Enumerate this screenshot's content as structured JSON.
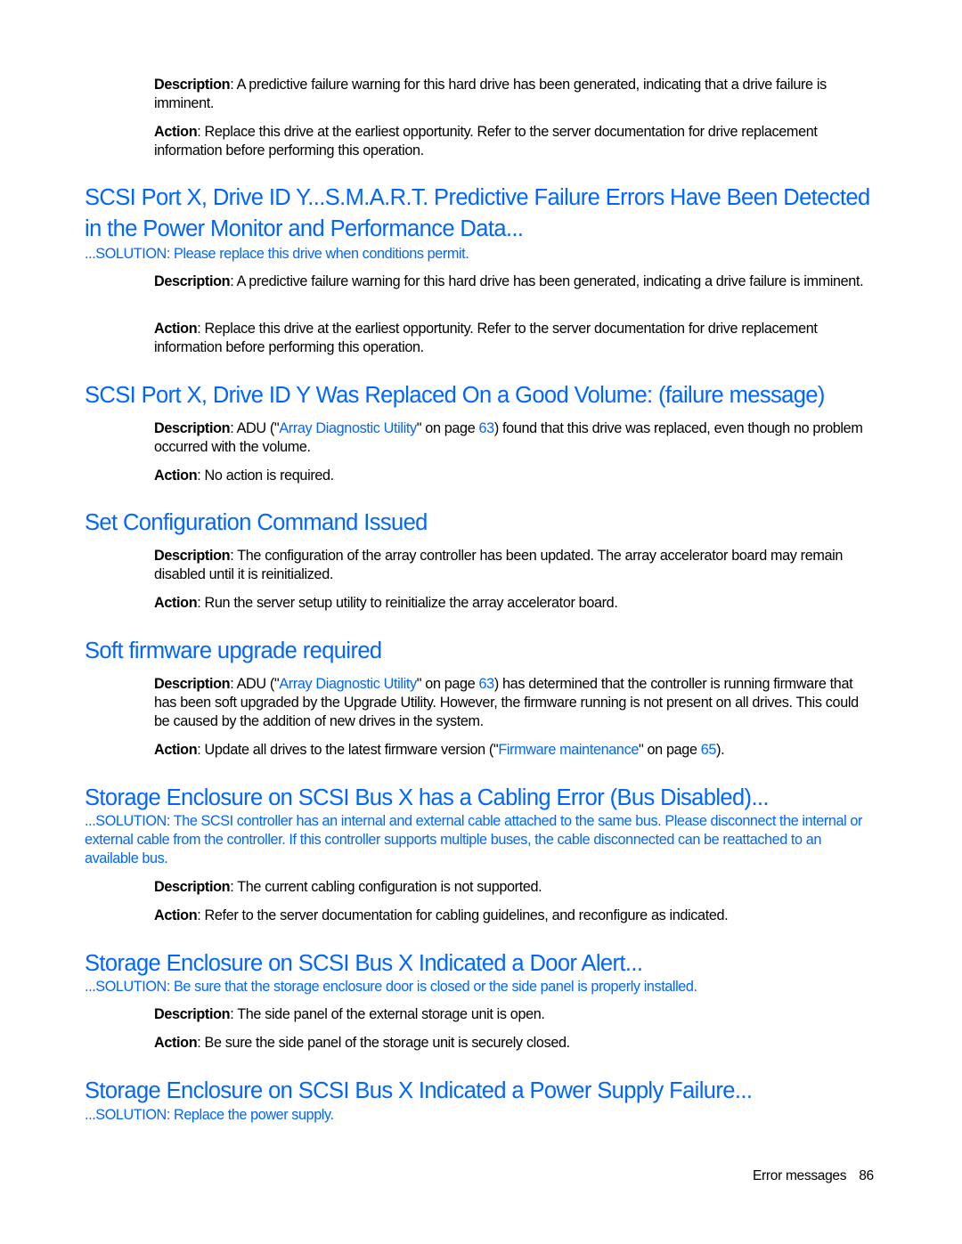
{
  "footer": {
    "section": "Error messages",
    "page": "86"
  },
  "labels": {
    "description": "Description",
    "action": "Action"
  },
  "block0": {
    "description": ": A predictive failure warning for this hard drive has been generated, indicating that a drive failure is imminent.",
    "action": ": Replace this drive at the earliest opportunity. Refer to the server documentation for drive replacement information before performing this operation."
  },
  "sections": [
    {
      "heading_line1": "SCSI Port X, Drive ID Y...S.M.A.R.T. Predictive Failure Errors Have Been Detected",
      "heading_line2": "in the Power Monitor and Performance Data...",
      "solution": "...SOLUTION: Please replace this drive when conditions permit.",
      "description": ": A predictive failure warning for this hard drive has been generated, indicating a drive failure is imminent.",
      "action": ": Replace this drive at the earliest opportunity. Refer to the server documentation for drive replacement information before performing this operation."
    },
    {
      "heading": "SCSI Port X, Drive ID Y Was Replaced On a Good Volume: (failure message)",
      "description_pre": ": ADU (\"",
      "description_link": "Array Diagnostic Utility",
      "description_mid": "\" on page ",
      "description_page": "63",
      "description_post": ") found that this drive was replaced, even though no problem occurred with the volume.",
      "action": ": No action is required."
    },
    {
      "heading": "Set Configuration Command Issued",
      "description": ": The configuration of the array controller has been updated. The array accelerator board may remain disabled until it is reinitialized.",
      "action": ": Run the server setup utility to reinitialize the array accelerator board."
    },
    {
      "heading": "Soft firmware upgrade required",
      "description_pre": ": ADU (\"",
      "description_link": "Array Diagnostic Utility",
      "description_mid": "\" on page ",
      "description_page": "63",
      "description_post": ") has determined that the controller is running firmware that has been soft upgraded by the Upgrade Utility. However, the firmware running is not present on all drives. This could be caused by the addition of new drives in the system.",
      "action_pre": ": Update all drives to the latest firmware version (\"",
      "action_link": "Firmware maintenance",
      "action_mid": "\" on page ",
      "action_page": "65",
      "action_post": ")."
    },
    {
      "heading": "Storage Enclosure on SCSI Bus X has a Cabling Error (Bus Disabled)...",
      "solution": "...SOLUTION: The SCSI controller has an internal and external cable attached to the same bus. Please disconnect the internal or external cable from the controller. If this controller supports multiple buses, the cable disconnected can be reattached to an available bus.",
      "description": ": The current cabling configuration is not supported.",
      "action": ": Refer to the server documentation for cabling guidelines, and reconfigure as indicated."
    },
    {
      "heading": "Storage Enclosure on SCSI Bus X Indicated a Door Alert...",
      "solution": "...SOLUTION: Be sure that the storage enclosure door is closed or the side panel is properly installed.",
      "description": ": The side panel of the external storage unit is open.",
      "action": ": Be sure the side panel of the storage unit is securely closed."
    },
    {
      "heading": "Storage Enclosure on SCSI Bus X Indicated a Power Supply Failure...",
      "solution": "...SOLUTION: Replace the power supply."
    }
  ]
}
